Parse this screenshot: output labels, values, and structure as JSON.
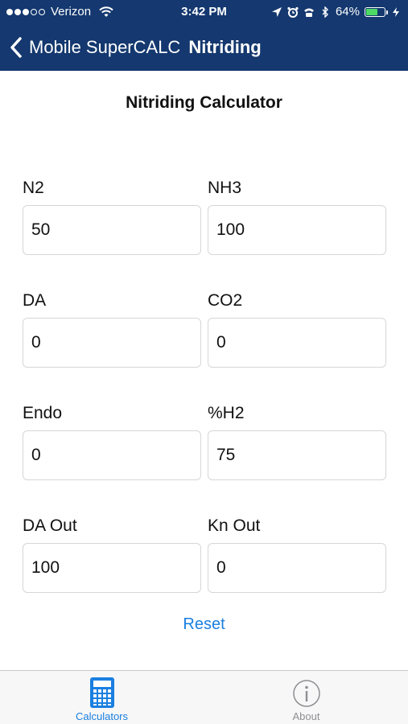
{
  "status_bar": {
    "carrier": "Verizon",
    "time": "3:42 PM",
    "battery": "64%",
    "battery_level": 0.64
  },
  "nav": {
    "back_label": "Mobile SuperCALC",
    "title": "Nitriding"
  },
  "page": {
    "title": "Nitriding Calculator"
  },
  "fields": {
    "n2": {
      "label": "N2",
      "value": "50"
    },
    "nh3": {
      "label": "NH3",
      "value": "100"
    },
    "da": {
      "label": "DA",
      "value": "0"
    },
    "co2": {
      "label": "CO2",
      "value": "0"
    },
    "endo": {
      "label": "Endo",
      "value": "0"
    },
    "h2": {
      "label": "%H2",
      "value": "75"
    },
    "da_out": {
      "label": "DA Out",
      "value": "100"
    },
    "kn_out": {
      "label": "Kn Out",
      "value": "0"
    }
  },
  "reset_label": "Reset",
  "tabs": {
    "calculators": {
      "label": "Calculators",
      "icon": "calculator-icon",
      "active": true
    },
    "about": {
      "label": "About",
      "icon": "info-icon",
      "active": false
    }
  },
  "colors": {
    "header_bg": "#14386f",
    "accent": "#1a7fe0",
    "inactive_tab": "#8e8e93",
    "battery_green": "#4cd964"
  }
}
